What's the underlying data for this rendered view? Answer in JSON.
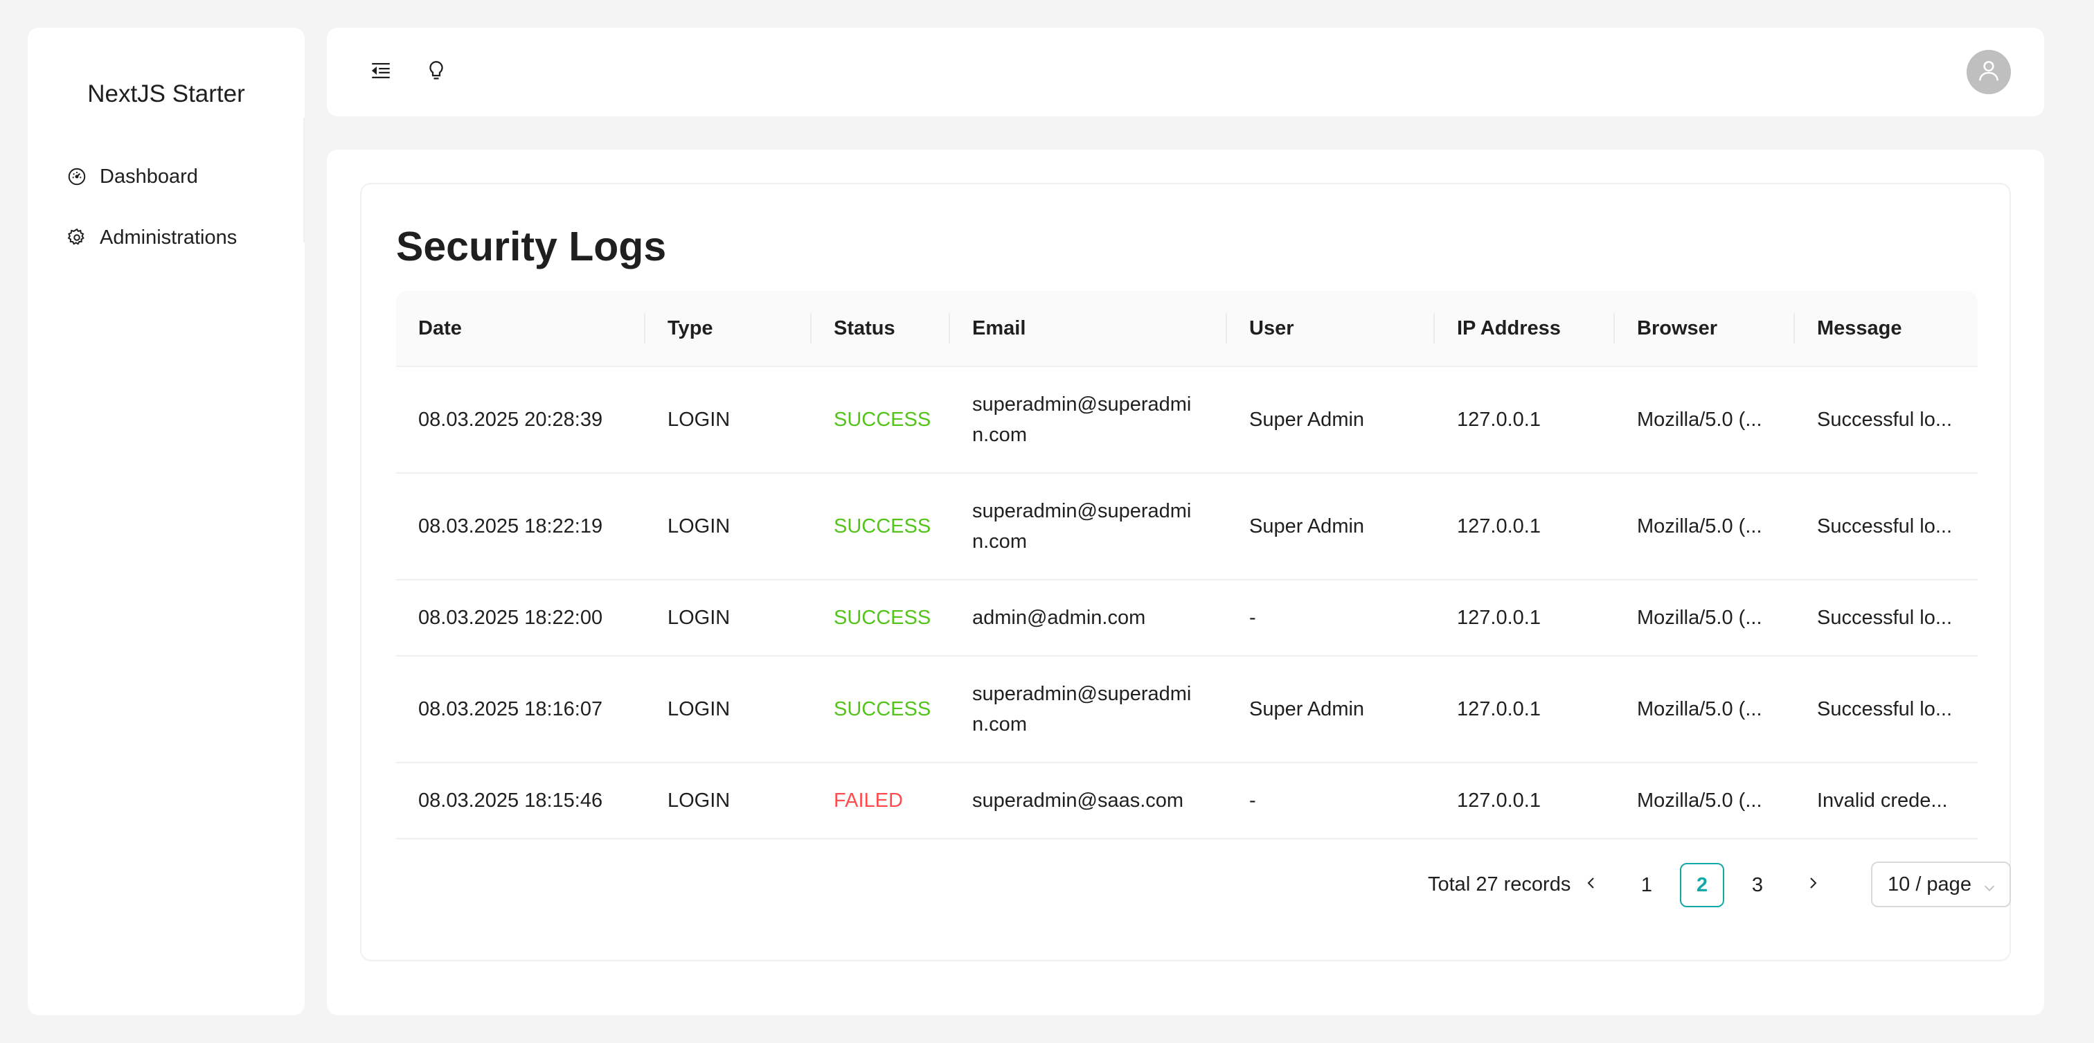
{
  "app": {
    "brand": "NextJS Starter"
  },
  "sidebar": {
    "items": [
      {
        "label": "Dashboard",
        "icon": "dashboard-icon"
      },
      {
        "label": "Administrations",
        "icon": "gear-icon"
      }
    ]
  },
  "header": {
    "icons": [
      "menu-fold-icon",
      "bulb-icon",
      "user-avatar-icon"
    ]
  },
  "main": {
    "title": "Security Logs",
    "columns": [
      "Date",
      "Type",
      "Status",
      "Email",
      "User",
      "IP Address",
      "Browser",
      "Message"
    ],
    "rows": [
      {
        "date": "08.03.2025 20:28:39",
        "type": "LOGIN",
        "status": "SUCCESS",
        "email": "superadmin@superadmin.com",
        "user": "Super Admin",
        "ip": "127.0.0.1",
        "browser": "Mozilla/5.0 (...",
        "message": "Successful lo..."
      },
      {
        "date": "08.03.2025 18:22:19",
        "type": "LOGIN",
        "status": "SUCCESS",
        "email": "superadmin@superadmin.com",
        "user": "Super Admin",
        "ip": "127.0.0.1",
        "browser": "Mozilla/5.0 (...",
        "message": "Successful lo..."
      },
      {
        "date": "08.03.2025 18:22:00",
        "type": "LOGIN",
        "status": "SUCCESS",
        "email": "admin@admin.com",
        "user": "-",
        "ip": "127.0.0.1",
        "browser": "Mozilla/5.0 (...",
        "message": "Successful lo..."
      },
      {
        "date": "08.03.2025 18:16:07",
        "type": "LOGIN",
        "status": "SUCCESS",
        "email": "superadmin@superadmin.com",
        "user": "Super Admin",
        "ip": "127.0.0.1",
        "browser": "Mozilla/5.0 (...",
        "message": "Successful lo..."
      },
      {
        "date": "08.03.2025 18:15:46",
        "type": "LOGIN",
        "status": "FAILED",
        "email": "superadmin@saas.com",
        "user": "-",
        "ip": "127.0.0.1",
        "browser": "Mozilla/5.0 (...",
        "message": "Invalid crede..."
      }
    ]
  },
  "pagination": {
    "total": "Total 27 records",
    "pages": [
      "1",
      "2",
      "3"
    ],
    "current": "2",
    "page_size": "10 / page"
  },
  "colors": {
    "accent": "#13a8a8",
    "success": "#52c41a",
    "failed": "#ff4d4f"
  }
}
